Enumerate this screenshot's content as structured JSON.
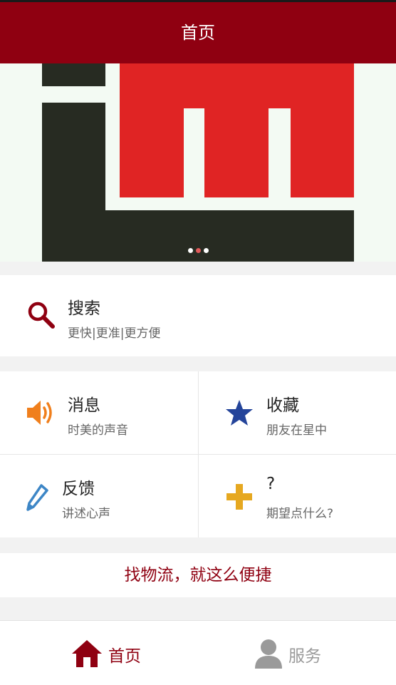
{
  "header": {
    "title": "首页"
  },
  "banner": {
    "slide_count": 3,
    "active_slide": 2,
    "colors": {
      "bg": "#f3faf3",
      "red": "#e02424",
      "dark": "#272b22"
    }
  },
  "search": {
    "title": "搜索",
    "subtitle": "更快|更准|更方便",
    "icon": "search-icon"
  },
  "grid": [
    {
      "title": "消息",
      "subtitle": "时美的声音",
      "icon": "speaker-icon"
    },
    {
      "title": "收藏",
      "subtitle": "朋友在星中",
      "icon": "star-icon"
    },
    {
      "title": "反馈",
      "subtitle": "讲述心声",
      "icon": "pencil-icon"
    },
    {
      "title": "?",
      "subtitle": "期望点什么?",
      "icon": "plus-icon"
    }
  ],
  "slogan": "找物流，就这么便捷",
  "tabbar": [
    {
      "label": "首页",
      "icon": "home-icon",
      "active": true
    },
    {
      "label": "服务",
      "icon": "person-icon",
      "active": false
    }
  ],
  "colors": {
    "brand": "#8f0011",
    "orange": "#f07f1c",
    "blue": "#24449a",
    "pencil": "#3d86c6",
    "yellow": "#e6a820",
    "inactive": "#9a9a9a"
  }
}
